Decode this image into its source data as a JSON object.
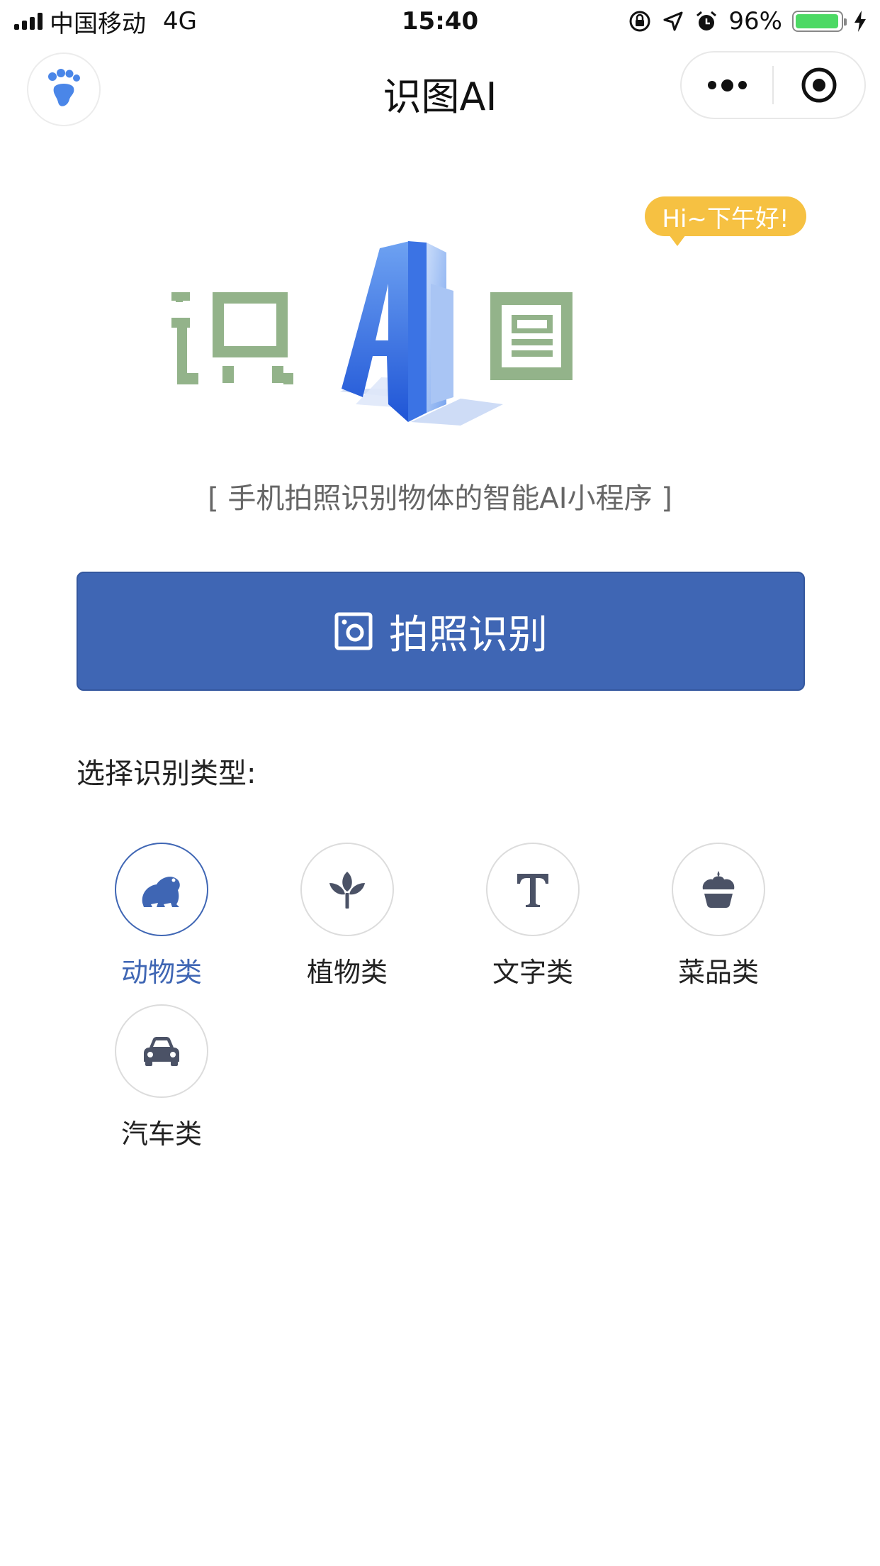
{
  "status_bar": {
    "carrier": "中国移动",
    "network": "4G",
    "time": "15:40",
    "battery_percent": "96%",
    "battery_level": 0.96,
    "battery_color": "#4cd964"
  },
  "nav": {
    "title": "识图AI",
    "avatar_icon": "footprint-icon",
    "more_icon": "more-dots-icon",
    "close_icon": "target-close-icon"
  },
  "logo": {
    "char_left": "识",
    "char_center": "Ai",
    "char_right": "图",
    "greeting": "Hi~下午好!"
  },
  "tagline": "[ 手机拍照识别物体的智能AI小程序 ]",
  "capture_button": {
    "label": "拍照识别",
    "icon": "camera-frame-icon"
  },
  "section_label": "选择识别类型:",
  "categories": [
    {
      "label": "动物类",
      "icon": "frog-icon",
      "active": true
    },
    {
      "label": "植物类",
      "icon": "plant-icon",
      "active": false
    },
    {
      "label": "文字类",
      "icon": "text-t-icon",
      "active": false
    },
    {
      "label": "菜品类",
      "icon": "cupcake-icon",
      "active": false
    },
    {
      "label": "汽车类",
      "icon": "car-icon",
      "active": false
    }
  ],
  "colors": {
    "primary": "#3f66b4",
    "logo_green": "#93b38a",
    "logo_blue": "#2f6fe0",
    "bubble": "#f6c142",
    "icon_dark": "#4b5266"
  }
}
